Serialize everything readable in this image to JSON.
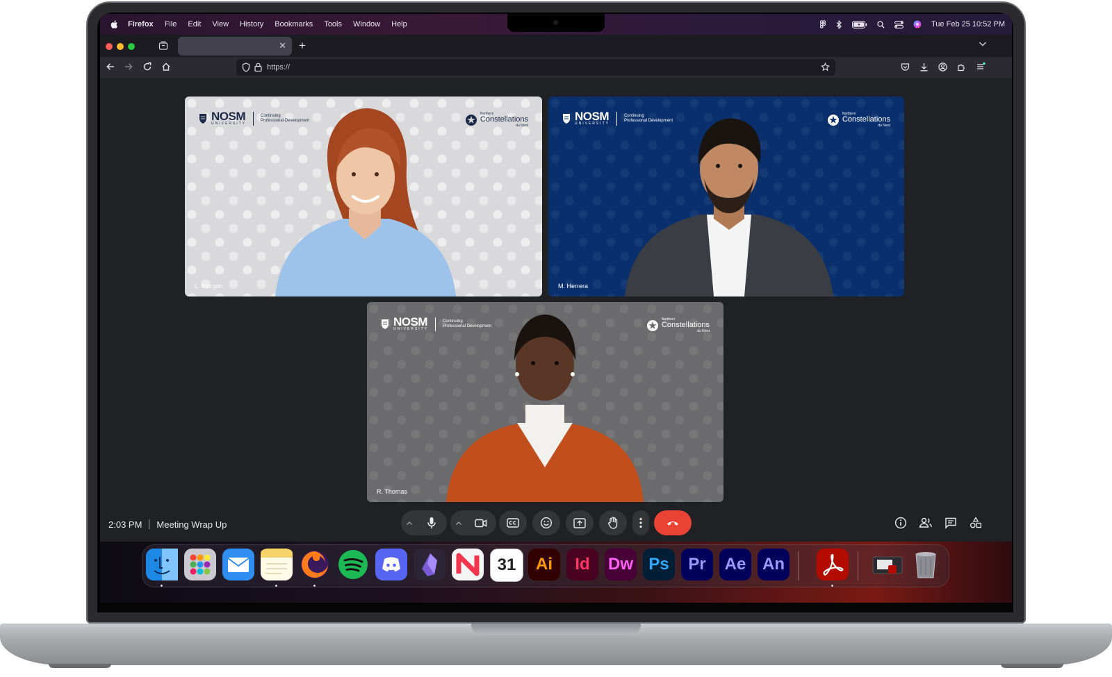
{
  "menubar": {
    "app": "Firefox",
    "menus": [
      "File",
      "Edit",
      "View",
      "History",
      "Bookmarks",
      "Tools",
      "Window",
      "Help"
    ],
    "datetime": "Tue Feb 25  10:52 PM"
  },
  "browser": {
    "url": "https://"
  },
  "tiles": [
    {
      "logo_main": "NOSM",
      "logo_uni": "UNIVERSITY",
      "logo_sub_1": "Continuing",
      "logo_sub_2": "Professional Development",
      "right_1": "Northern",
      "right_2": "Constellations",
      "right_3": "du Nord",
      "name": "L. Morgan"
    },
    {
      "logo_main": "NOSM",
      "logo_uni": "UNIVERSITY",
      "logo_sub_1": "Continuing",
      "logo_sub_2": "Professional Development",
      "right_1": "Northern",
      "right_2": "Constellations",
      "right_3": "du Nord",
      "name": "M. Herrera"
    },
    {
      "logo_main": "NOSM",
      "logo_uni": "UNIVERSITY",
      "logo_sub_1": "Continuing",
      "logo_sub_2": "Professional Development",
      "right_1": "Northern",
      "right_2": "Constellations",
      "right_3": "du Nord",
      "name": "R. Thomas"
    }
  ],
  "meeting": {
    "time": "2:03 PM",
    "title": "Meeting Wrap Up",
    "controls": [
      "mic-icon",
      "camera-icon",
      "captions-icon",
      "emoji-icon",
      "present-icon",
      "raise-hand-icon",
      "more-icon",
      "end-call-icon"
    ],
    "right_controls": [
      "info-icon",
      "people-icon",
      "chat-icon",
      "activities-icon"
    ]
  },
  "dock": {
    "apps": [
      {
        "name": "Finder",
        "label": "",
        "bg": "#1e88e5",
        "fg": "#ffffff"
      },
      {
        "name": "Launchpad",
        "label": "",
        "bg": "#c9c9cf",
        "fg": "#333333"
      },
      {
        "name": "Mail",
        "label": "",
        "bg": "#2f8ef0",
        "fg": "#ffffff"
      },
      {
        "name": "Notes",
        "label": "",
        "bg": "#f6d46a",
        "fg": "#8a6b12"
      },
      {
        "name": "Firefox",
        "label": "",
        "bg": "#3a1a5c",
        "fg": "#ff7a1a"
      },
      {
        "name": "Spotify",
        "label": "",
        "bg": "#1db954",
        "fg": "#111111"
      },
      {
        "name": "Discord",
        "label": "",
        "bg": "#5865f2",
        "fg": "#ffffff"
      },
      {
        "name": "Obsidian",
        "label": "",
        "bg": "#2b2536",
        "fg": "#a88bfa"
      },
      {
        "name": "News",
        "label": "",
        "bg": "#f5f5f5",
        "fg": "#f2344d"
      },
      {
        "name": "Calendar",
        "label": "31",
        "bg": "#ffffff",
        "fg": "#222222"
      },
      {
        "name": "Illustrator",
        "label": "Ai",
        "bg": "#330000",
        "fg": "#ff9a00"
      },
      {
        "name": "InDesign",
        "label": "Id",
        "bg": "#49021f",
        "fg": "#ff3366"
      },
      {
        "name": "Dreamweaver",
        "label": "Dw",
        "bg": "#470137",
        "fg": "#ff61f6"
      },
      {
        "name": "Photoshop",
        "label": "Ps",
        "bg": "#001e36",
        "fg": "#31a8ff"
      },
      {
        "name": "Premiere Pro",
        "label": "Pr",
        "bg": "#00005b",
        "fg": "#9999ff"
      },
      {
        "name": "After Effects",
        "label": "Ae",
        "bg": "#00005b",
        "fg": "#9999ff"
      },
      {
        "name": "Animate",
        "label": "An",
        "bg": "#00005b",
        "fg": "#9999ff"
      },
      {
        "name": "Acrobat",
        "label": "",
        "bg": "#b30b00",
        "fg": "#ffffff"
      },
      {
        "name": "Downloads",
        "label": "",
        "bg": "#2a2a30",
        "fg": "#ffffff"
      },
      {
        "name": "Trash",
        "label": "",
        "bg": "#6d6f75",
        "fg": "#cfd1d6"
      }
    ]
  },
  "colors": {
    "end_call": "#ea4335",
    "tile_blue": "#0a2f6d",
    "tile_light": "#d9d9db",
    "tile_grey": "#6b6b6d"
  }
}
